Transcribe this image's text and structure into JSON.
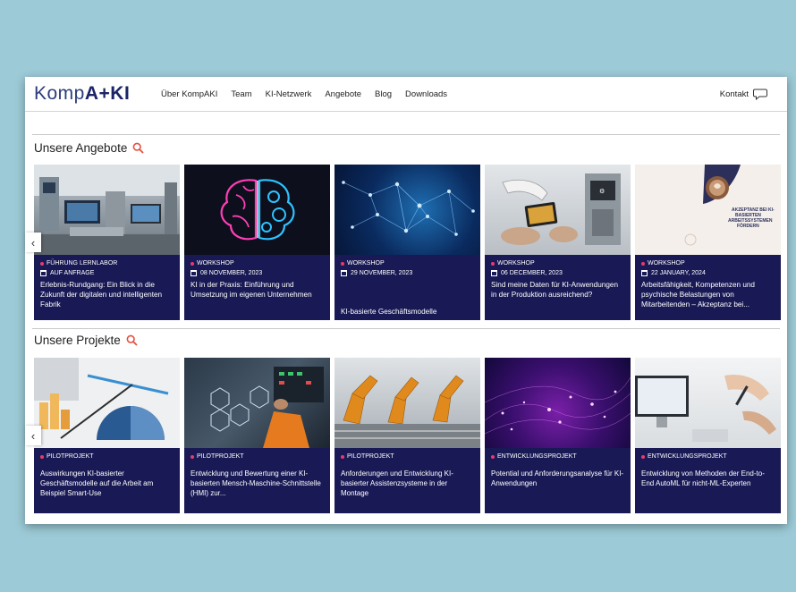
{
  "nav": {
    "logo": {
      "part1": "Komp",
      "part2": "A+KI"
    },
    "items": [
      {
        "label": "Über KompAKI"
      },
      {
        "label": "Team"
      },
      {
        "label": "KI-Netzwerk"
      },
      {
        "label": "Angebote"
      },
      {
        "label": "Blog"
      },
      {
        "label": "Downloads"
      }
    ],
    "kontakt": "Kontakt"
  },
  "angebote": {
    "title": "Unsere Angebote",
    "cards": [
      {
        "category": "Führung Lernlabor",
        "date": "Auf Anfrage",
        "title": "Erlebnis-Rundgang: Ein Blick in die Zukunft der digitalen und intelligenten Fabrik"
      },
      {
        "category": "Workshop",
        "date": "08 November, 2023",
        "title": "KI in der Praxis: Einführung und Umsetzung im eigenen Unternehmen"
      },
      {
        "category": "Workshop",
        "date": "29 November, 2023",
        "title": "KI-basierte Geschäftsmodelle"
      },
      {
        "category": "Workshop",
        "date": "06 December, 2023",
        "title": "Sind meine Daten für KI-Anwendungen in der Produktion ausreichend?"
      },
      {
        "category": "Workshop",
        "date": "22 January, 2024",
        "title": "Arbeitsfähigkeit, Kompetenzen und psychische Belastungen von Mitarbeitenden – Akzeptanz bei..."
      }
    ],
    "image5_text": "AKZEPTANZ BEI KI-BASIERTEN ARBEITSSYSTEMEN FÖRDERN"
  },
  "projekte": {
    "title": "Unsere Projekte",
    "cards": [
      {
        "category": "Pilotprojekt",
        "title": "Auswirkungen KI-basierter Geschäftsmodelle auf die Arbeit am Beispiel Smart-Use"
      },
      {
        "category": "Pilotprojekt",
        "title": "Entwicklung und Bewertung einer KI-basierten Mensch-Maschine-Schnittstelle (HMI) zur..."
      },
      {
        "category": "Pilotprojekt",
        "title": "Anforderungen und Entwicklung KI-basierter Assistenzsysteme in der Montage"
      },
      {
        "category": "Entwicklungsprojekt",
        "title": "Potential und Anforderungsanalyse für KI-Anwendungen"
      },
      {
        "category": "Entwicklungsprojekt",
        "title": "Entwicklung von Methoden der End-to-End AutoML für nicht-ML-Experten"
      }
    ]
  },
  "icons": {
    "search": "search-icon",
    "chat": "chat-bubble-icon",
    "prev": "chevron-left-icon",
    "calendar": "calendar-icon"
  },
  "colors": {
    "card_bg": "#191a55",
    "accent": "#e73b6e",
    "page_bg": "#9ccad6",
    "logo": "#2b3c7c"
  }
}
